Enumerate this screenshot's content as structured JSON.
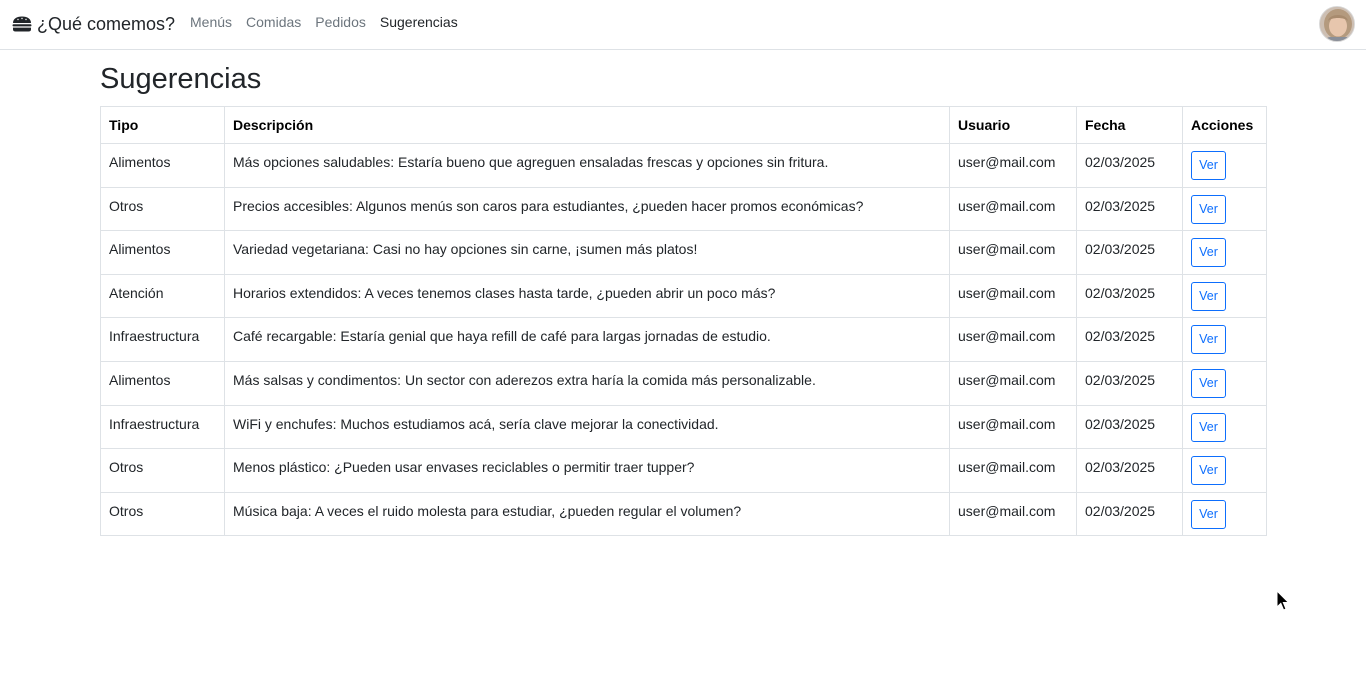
{
  "brand": {
    "title": "¿Qué comemos?",
    "icon": "burger-icon"
  },
  "nav": {
    "items": [
      {
        "label": "Menús",
        "active": false
      },
      {
        "label": "Comidas",
        "active": false
      },
      {
        "label": "Pedidos",
        "active": false
      },
      {
        "label": "Sugerencias",
        "active": true
      }
    ]
  },
  "user": {
    "avatar": "user-avatar"
  },
  "page": {
    "title": "Sugerencias"
  },
  "table": {
    "headers": {
      "tipo": "Tipo",
      "descripcion": "Descripción",
      "usuario": "Usuario",
      "fecha": "Fecha",
      "acciones": "Acciones"
    },
    "rows": [
      {
        "tipo": "Alimentos",
        "descripcion": "Más opciones saludables: Estaría bueno que agreguen ensaladas frescas y opciones sin fritura.",
        "usuario": "user@mail.com",
        "fecha": "02/03/2025",
        "action": "Ver"
      },
      {
        "tipo": "Otros",
        "descripcion": "Precios accesibles: Algunos menús son caros para estudiantes, ¿pueden hacer promos económicas?",
        "usuario": "user@mail.com",
        "fecha": "02/03/2025",
        "action": "Ver"
      },
      {
        "tipo": "Alimentos",
        "descripcion": "Variedad vegetariana: Casi no hay opciones sin carne, ¡sumen más platos!",
        "usuario": "user@mail.com",
        "fecha": "02/03/2025",
        "action": "Ver"
      },
      {
        "tipo": "Atención",
        "descripcion": "Horarios extendidos: A veces tenemos clases hasta tarde, ¿pueden abrir un poco más?",
        "usuario": "user@mail.com",
        "fecha": "02/03/2025",
        "action": "Ver"
      },
      {
        "tipo": "Infraestructura",
        "descripcion": "Café recargable: Estaría genial que haya refill de café para largas jornadas de estudio.",
        "usuario": "user@mail.com",
        "fecha": "02/03/2025",
        "action": "Ver"
      },
      {
        "tipo": "Alimentos",
        "descripcion": "Más salsas y condimentos: Un sector con aderezos extra haría la comida más personalizable.",
        "usuario": "user@mail.com",
        "fecha": "02/03/2025",
        "action": "Ver"
      },
      {
        "tipo": "Infraestructura",
        "descripcion": "WiFi y enchufes: Muchos estudiamos acá, sería clave mejorar la conectividad.",
        "usuario": "user@mail.com",
        "fecha": "02/03/2025",
        "action": "Ver"
      },
      {
        "tipo": "Otros",
        "descripcion": "Menos plástico: ¿Pueden usar envases reciclables o permitir traer tupper?",
        "usuario": "user@mail.com",
        "fecha": "02/03/2025",
        "action": "Ver"
      },
      {
        "tipo": "Otros",
        "descripcion": "Música baja: A veces el ruido molesta para estudiar, ¿pueden regular el volumen?",
        "usuario": "user@mail.com",
        "fecha": "02/03/2025",
        "action": "Ver"
      }
    ]
  },
  "colors": {
    "primary": "#0d6efd",
    "border": "#dee2e6",
    "text": "#212529",
    "muted": "#6c757d"
  }
}
